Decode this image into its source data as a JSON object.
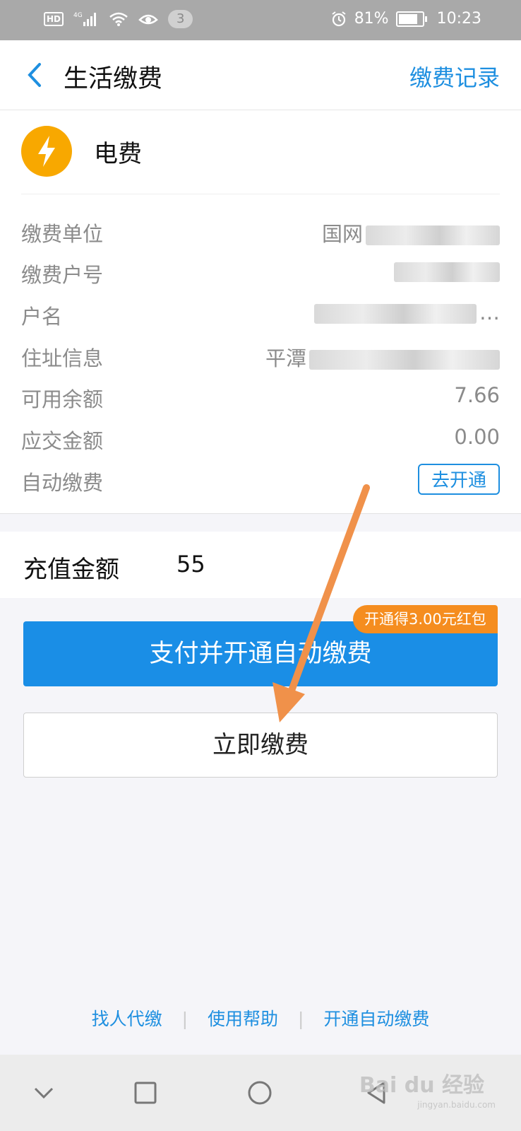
{
  "status_bar": {
    "network": "4G",
    "notification_count": "3",
    "battery": "81%",
    "battery_level": 0.81,
    "time": "10:23"
  },
  "header": {
    "title": "生活缴费",
    "records_link": "缴费记录"
  },
  "bill": {
    "name": "电费",
    "icon": "lightning-icon",
    "icon_color": "#f8a800",
    "rows": [
      {
        "label": "缴费单位",
        "value": "国网"
      },
      {
        "label": "缴费户号",
        "value": ""
      },
      {
        "label": "户名",
        "value": "…"
      },
      {
        "label": "住址信息",
        "value": "平潭"
      },
      {
        "label": "可用余额",
        "value": "7.66"
      },
      {
        "label": "应交金额",
        "value": "0.00"
      },
      {
        "label": "自动缴费",
        "value": ""
      }
    ],
    "auto_pay_button": "去开通"
  },
  "recharge": {
    "label": "充值金额",
    "value": "55"
  },
  "buttons": {
    "pay_and_auto": "支付并开通自动缴费",
    "promo": "开通得3.00元红包",
    "pay_now": "立即缴费"
  },
  "footer": {
    "links": [
      "找人代缴",
      "使用帮助",
      "开通自动缴费"
    ],
    "separator": "|"
  },
  "colors": {
    "accent": "#1e8fe0",
    "primary_button": "#1a8ee6",
    "promo": "#f58d1f",
    "annotation_arrow": "#f0914a"
  },
  "watermark": {
    "text": "Bai du 经验",
    "sub": "jingyan.baidu.com"
  }
}
